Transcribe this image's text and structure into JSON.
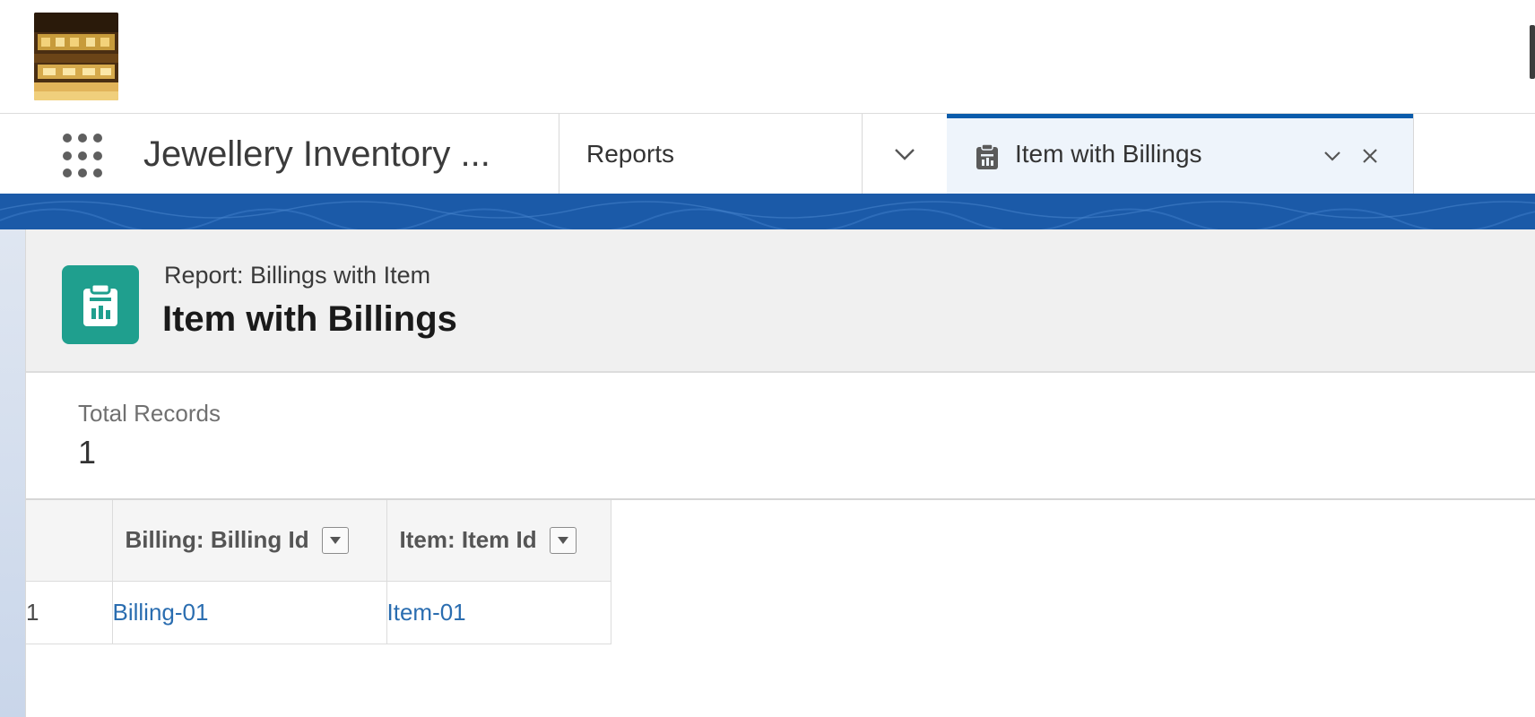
{
  "app": {
    "name": "Jewellery Inventory ...",
    "logo_icon": "jewellery-store-photo"
  },
  "tabs": [
    {
      "label": "Reports",
      "active": false
    },
    {
      "label": "Item with Billings",
      "active": true,
      "icon": "report-icon"
    }
  ],
  "colors": {
    "brand_blue": "#1b5aa8",
    "active_tab_border": "#0b5cab",
    "report_icon_bg": "#1f9f8e",
    "link": "#2a6db0"
  },
  "report": {
    "kind_label": "Report: Billings with Item",
    "title": "Item with Billings",
    "totals": {
      "label": "Total Records",
      "value": "1"
    },
    "table": {
      "columns": [
        {
          "label": "Billing: Billing Id"
        },
        {
          "label": "Item: Item Id"
        }
      ],
      "rows": [
        {
          "num": "1",
          "cells": [
            "Billing-01",
            "Item-01"
          ]
        }
      ]
    }
  }
}
